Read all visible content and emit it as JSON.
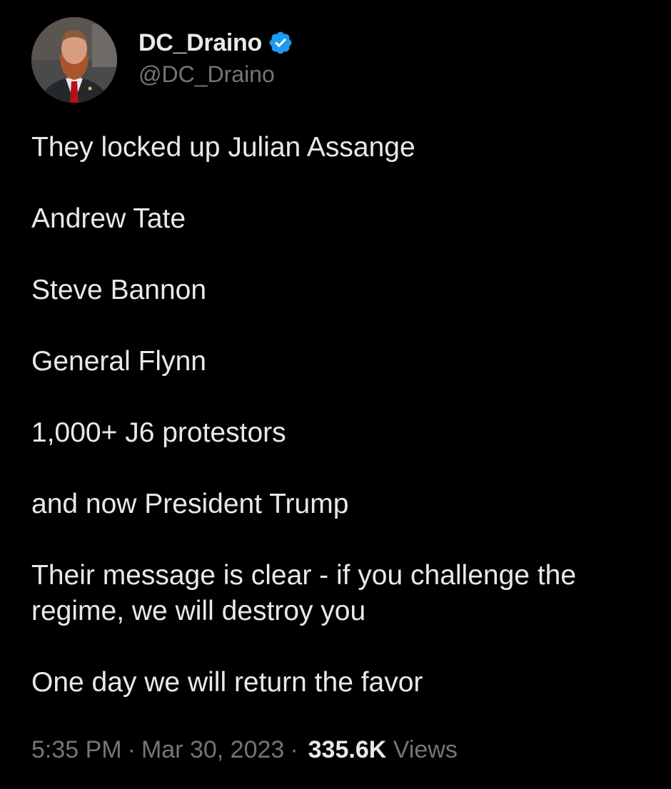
{
  "author": {
    "display_name": "DC_Draino",
    "handle": "@DC_Draino",
    "verified": true,
    "verified_color": "#1d9bf0"
  },
  "tweet": {
    "paragraphs": [
      "They locked up Julian Assange",
      "Andrew Tate",
      "Steve Bannon",
      "General Flynn",
      "1,000+ J6 protestors",
      "and now President Trump",
      "Their message is clear - if you challenge the regime, we will destroy you",
      "One day we will return the favor"
    ]
  },
  "meta": {
    "time": "5:35 PM",
    "separator": "·",
    "date": "Mar 30, 2023",
    "views_count": "335.6K",
    "views_label": "Views"
  },
  "icons": {
    "more": "more-horizontal-icon",
    "verified": "verified-badge-icon"
  },
  "colors": {
    "background": "#000000",
    "primary_text": "#e7e9ea",
    "secondary_text": "#71767b"
  }
}
